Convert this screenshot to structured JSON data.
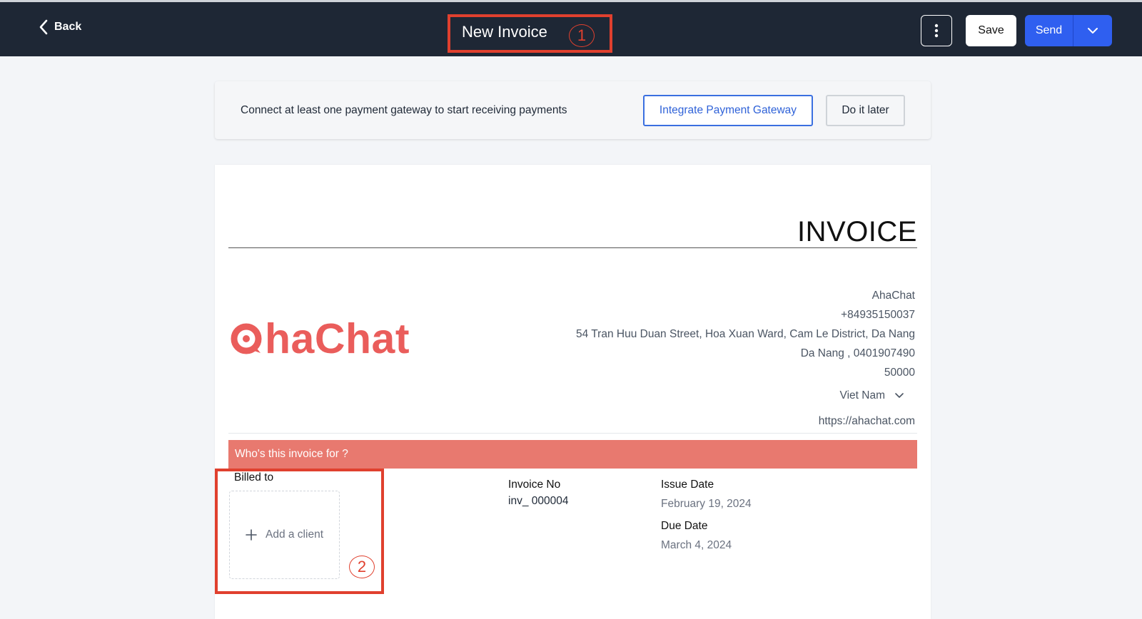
{
  "header": {
    "back_label": "Back",
    "title": "New Invoice",
    "callout_1": "1",
    "save_label": "Save",
    "send_label": "Send"
  },
  "gateway": {
    "message": "Connect at least one payment gateway to start receiving payments",
    "integrate_label": "Integrate Payment Gateway",
    "later_label": "Do it later"
  },
  "invoice": {
    "heading": "INVOICE",
    "logo_text": "haChat",
    "company": {
      "name": "AhaChat",
      "phone": "+84935150037",
      "address": "54 Tran Huu Duan Street, Hoa Xuan Ward, Cam Le District, Da Nang",
      "city_line": "Da Nang ,  0401907490",
      "postal": "50000",
      "country": "Viet Nam",
      "website": "https://ahachat.com"
    },
    "who_for": "Who's this invoice for ?",
    "billed_to": "Billed to",
    "add_client": "Add a client",
    "callout_2": "2",
    "invoice_no_label": "Invoice No",
    "invoice_no_value": "inv_  000004",
    "issue_date_label": "Issue Date",
    "issue_date_value": "February 19, 2024",
    "due_date_label": "Due Date",
    "due_date_value": "March 4, 2024"
  },
  "colors": {
    "topbar": "#1e2735",
    "accent_blue": "#2f5ff0",
    "brand_red": "#ea5d5b",
    "who_bar": "#e8796f",
    "annotation_red": "#e0402e"
  }
}
